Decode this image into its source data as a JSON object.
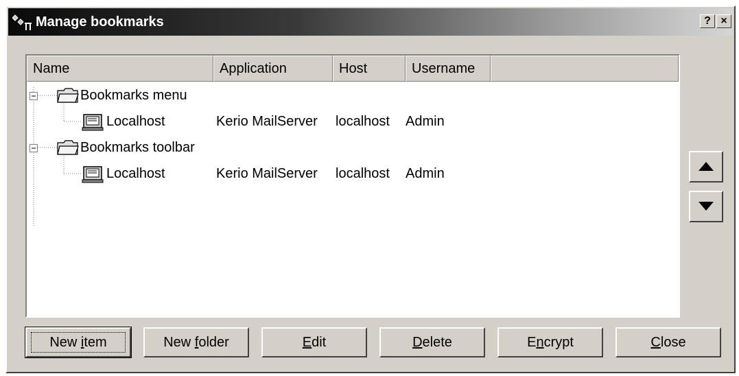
{
  "window": {
    "title": "Manage bookmarks",
    "help_label": "?",
    "close_label": "×"
  },
  "columns": [
    "Name",
    "Application",
    "Host",
    "Username"
  ],
  "tree": [
    {
      "label": "Bookmarks menu",
      "children": [
        {
          "name": "Localhost",
          "application": "Kerio MailServer",
          "host": "localhost",
          "username": "Admin"
        }
      ]
    },
    {
      "label": "Bookmarks toolbar",
      "children": [
        {
          "name": "Localhost",
          "application": "Kerio MailServer",
          "host": "localhost",
          "username": "Admin"
        }
      ]
    }
  ],
  "buttons": {
    "new_item": {
      "pre": "New ",
      "accel": "i",
      "post": "tem"
    },
    "new_folder": {
      "pre": "New ",
      "accel": "f",
      "post": "older"
    },
    "edit": {
      "pre": "",
      "accel": "E",
      "post": "dit"
    },
    "delete": {
      "pre": "",
      "accel": "D",
      "post": "elete"
    },
    "encrypt": {
      "pre": "E",
      "accel": "n",
      "post": "crypt"
    },
    "close": {
      "pre": "",
      "accel": "C",
      "post": "lose"
    }
  },
  "icons": {
    "app": "bookmarks-app-icon",
    "folder": "folder-icon",
    "bookmark": "computer-icon",
    "move_up": "arrow-up-icon",
    "move_down": "arrow-down-icon",
    "expander": "collapse-minus-icon"
  }
}
